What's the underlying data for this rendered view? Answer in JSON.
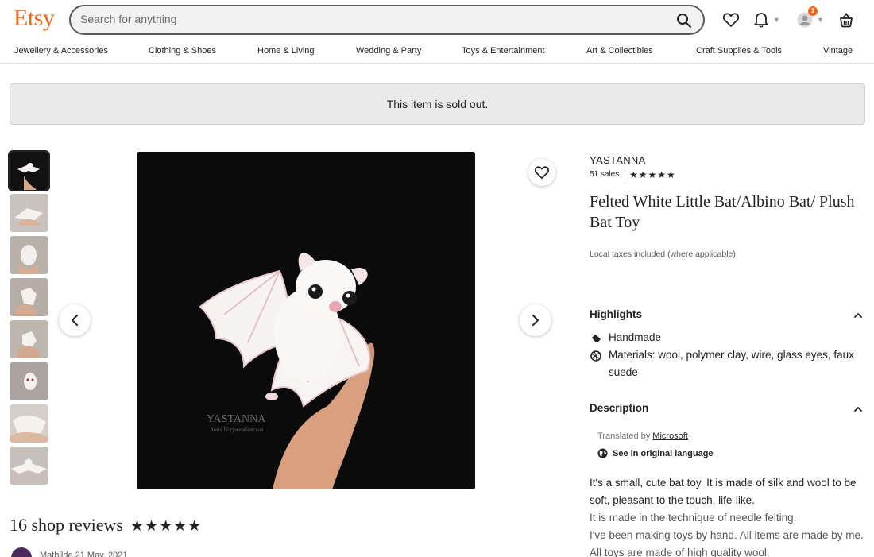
{
  "header": {
    "logo": "Etsy",
    "search_placeholder": "Search for anything",
    "cart_badge": "1"
  },
  "nav": {
    "items": [
      "Jewellery & Accessories",
      "Clothing & Shoes",
      "Home & Living",
      "Wedding & Party",
      "Toys & Entertainment",
      "Art & Collectibles",
      "Craft Supplies & Tools",
      "Vintage"
    ]
  },
  "banner": {
    "text": "This item is sold out."
  },
  "gallery": {
    "thumbnail_count": 8,
    "watermark_line1": "YASTANNA",
    "watermark_line2": "Анна Ястржембовская"
  },
  "listing": {
    "shop_name": "YASTANNA",
    "sales": "51 sales",
    "rating_stars": "★★★★★",
    "title": "Felted White Little Bat/Albino Bat/ Plush Bat Toy",
    "taxes_note": "Local taxes included (where applicable)"
  },
  "highlights": {
    "heading": "Highlights",
    "items": [
      {
        "icon": "hand-icon",
        "text": "Handmade"
      },
      {
        "icon": "yarn-icon",
        "text": "Materials: wool, polymer clay, wire, glass eyes, faux suede"
      }
    ]
  },
  "description": {
    "heading": "Description",
    "translated_by_prefix": "Translated by ",
    "translated_by_link": "Microsoft",
    "see_original": "See in original language",
    "paragraphs": [
      "It's a small, cute bat toy. It is made of silk and wool to be soft, pleasant to the touch, life-like.",
      "It is made in the technique of needle felting.",
      "I've been making toys by hand. All items are made by me. All toys are made of high quality wool."
    ]
  },
  "reviews": {
    "title": "16 shop reviews",
    "stars": "★★★★★",
    "first_reviewer": "Mathilde  21 May, 2021"
  },
  "colors": {
    "brand": "#F1641E",
    "text": "#222222",
    "banner_bg": "#EAEAEA"
  }
}
